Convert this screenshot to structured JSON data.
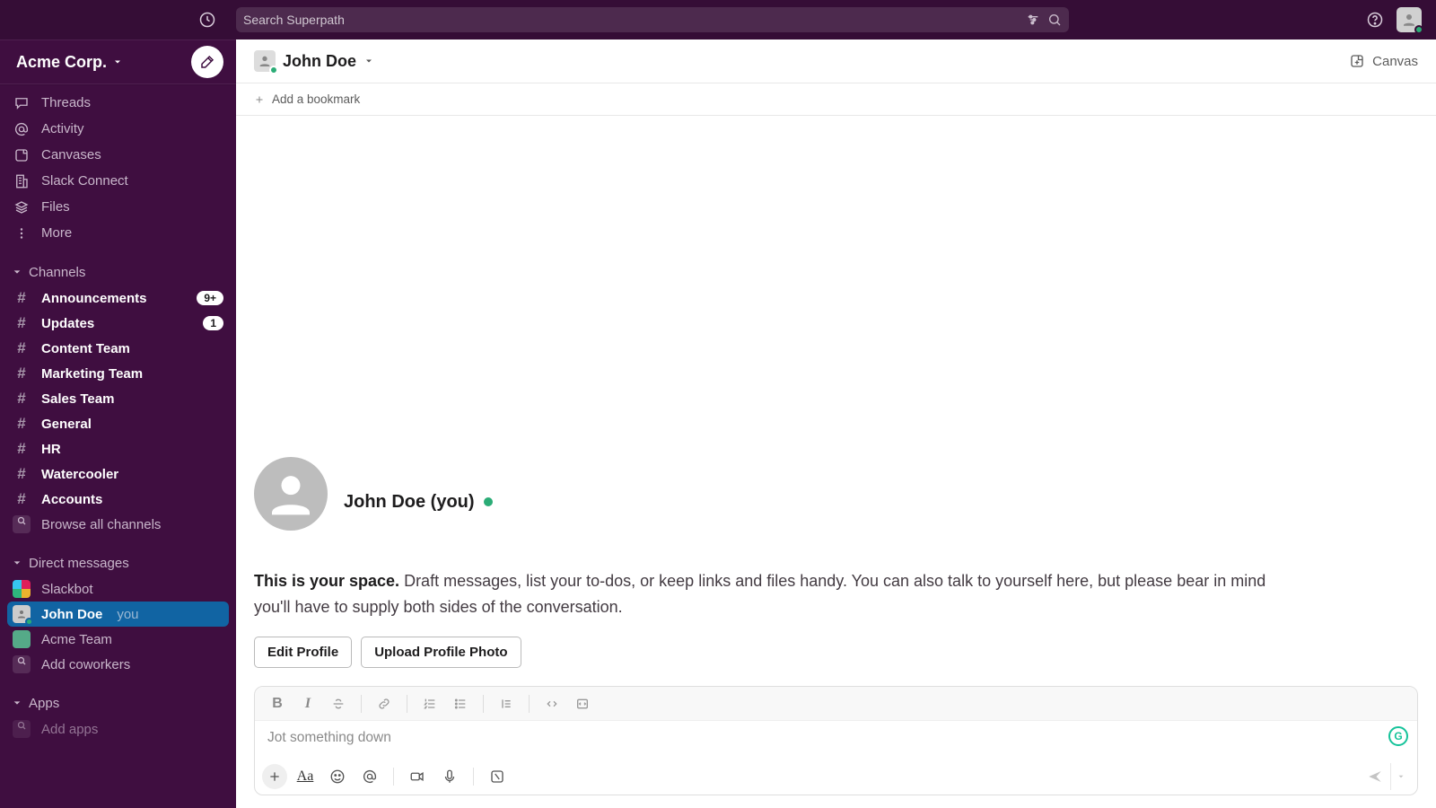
{
  "search": {
    "placeholder": "Search Superpath"
  },
  "workspace": {
    "name": "Acme Corp."
  },
  "nav": {
    "threads": "Threads",
    "activity": "Activity",
    "canvases": "Canvases",
    "connect": "Slack Connect",
    "files": "Files",
    "more": "More"
  },
  "sections": {
    "channels": "Channels",
    "dms": "Direct messages",
    "apps": "Apps"
  },
  "channels": [
    {
      "name": "Announcements",
      "badge": "9+"
    },
    {
      "name": "Updates",
      "badge": "1"
    },
    {
      "name": "Content Team"
    },
    {
      "name": "Marketing Team"
    },
    {
      "name": "Sales Team"
    },
    {
      "name": "General"
    },
    {
      "name": "HR"
    },
    {
      "name": "Watercooler"
    },
    {
      "name": "Accounts"
    }
  ],
  "browse_channels": "Browse all channels",
  "dms": [
    {
      "name": "Slackbot"
    },
    {
      "name": "John Doe",
      "you": "you",
      "active": true
    },
    {
      "name": "Acme Team"
    }
  ],
  "add_coworkers": "Add coworkers",
  "add_apps": "Add apps",
  "header": {
    "title": "John Doe",
    "canvas": "Canvas",
    "bookmark": "Add a bookmark"
  },
  "intro": {
    "name": "John Doe (you)",
    "bold": "This is your space.",
    "rest": " Draft messages, list your to-dos, or keep links and files handy. You can also talk to yourself here, but please bear in mind you'll have to supply both sides of the conversation.",
    "edit": "Edit Profile",
    "upload": "Upload Profile Photo"
  },
  "composer": {
    "placeholder": "Jot something down"
  }
}
